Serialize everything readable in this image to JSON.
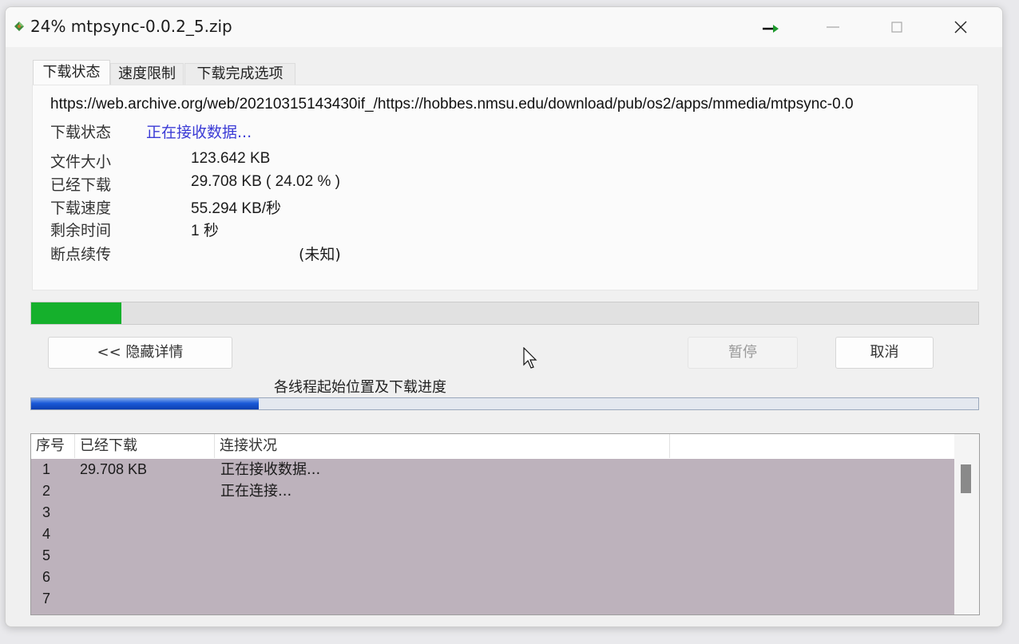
{
  "window": {
    "title": "24% mtpsync-0.0.2_5.zip",
    "accent_color": "#15b02c"
  },
  "tabs": [
    {
      "label": "下载状态"
    },
    {
      "label": "速度限制"
    },
    {
      "label": "下载完成选项"
    }
  ],
  "details": {
    "url": "https://web.archive.org/web/20210315143430if_/https://hobbes.nmsu.edu/download/pub/os2/apps/mmedia/mtpsync-0.0",
    "status_label": "下载状态",
    "status_value": "正在接收数据...",
    "file_size_label": "文件大小",
    "file_size_value": "123.642  KB",
    "downloaded_label": "已经下载",
    "downloaded_value": "29.708  KB  ( 24.02 % )",
    "speed_label": "下载速度",
    "speed_value": "55.294  KB/秒",
    "remaining_label": "剩余时间",
    "remaining_value": "1 秒",
    "resume_label": "断点续传",
    "resume_value": "(未知)"
  },
  "progress": {
    "percent": 9.5
  },
  "buttons": {
    "hide_details": "<< 隐藏详情",
    "pause": "暂停",
    "cancel": "取消"
  },
  "threads": {
    "caption": "各线程起始位置及下载进度",
    "progress_percent": 24.0,
    "columns": [
      "序号",
      "已经下载",
      "连接状况"
    ],
    "rows": [
      {
        "index": "1",
        "downloaded": "29.708  KB",
        "status": "正在接收数据..."
      },
      {
        "index": "2",
        "downloaded": "",
        "status": "正在连接..."
      },
      {
        "index": "3",
        "downloaded": "",
        "status": ""
      },
      {
        "index": "4",
        "downloaded": "",
        "status": ""
      },
      {
        "index": "5",
        "downloaded": "",
        "status": ""
      },
      {
        "index": "6",
        "downloaded": "",
        "status": ""
      },
      {
        "index": "7",
        "downloaded": "",
        "status": ""
      }
    ]
  }
}
